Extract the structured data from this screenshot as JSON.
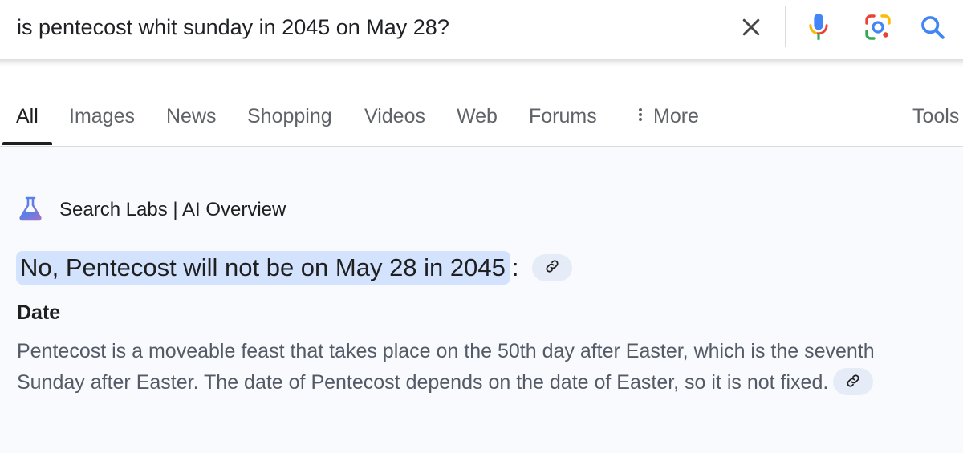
{
  "search": {
    "query": "is pentecost whit sunday in 2045 on May 28?",
    "icons": [
      "close-icon",
      "microphone-icon",
      "google-lens-icon",
      "search-icon"
    ]
  },
  "tabs": [
    {
      "label": "All",
      "active": true
    },
    {
      "label": "Images",
      "active": false
    },
    {
      "label": "News",
      "active": false
    },
    {
      "label": "Shopping",
      "active": false
    },
    {
      "label": "Videos",
      "active": false
    },
    {
      "label": "Web",
      "active": false
    },
    {
      "label": "Forums",
      "active": false
    },
    {
      "label": "More",
      "active": false,
      "icon": "more-vert-icon"
    },
    {
      "label": "Tools",
      "active": false
    }
  ],
  "overview": {
    "header_label": "Search Labs | AI Overview",
    "header_icon": "flask-icon",
    "answer_text": "No, Pentecost will not be on May 28 in 2045",
    "answer_suffix": ":",
    "section_heading": "Date",
    "body": "Pentecost is a moveable feast that takes place on the 50th day after Easter, which is the seventh Sunday after Easter. The date of Pentecost depends on the date of Easter, so it is not fixed.",
    "link_icon": "link-icon"
  },
  "colors": {
    "answer_highlight": "#d3e3fd",
    "panel_background": "#f8fafd",
    "link_chip": "#e6ecf7",
    "google_blue": "#4285f4",
    "google_red": "#ea4335",
    "google_yellow": "#fbbc04",
    "google_green": "#34a853"
  }
}
